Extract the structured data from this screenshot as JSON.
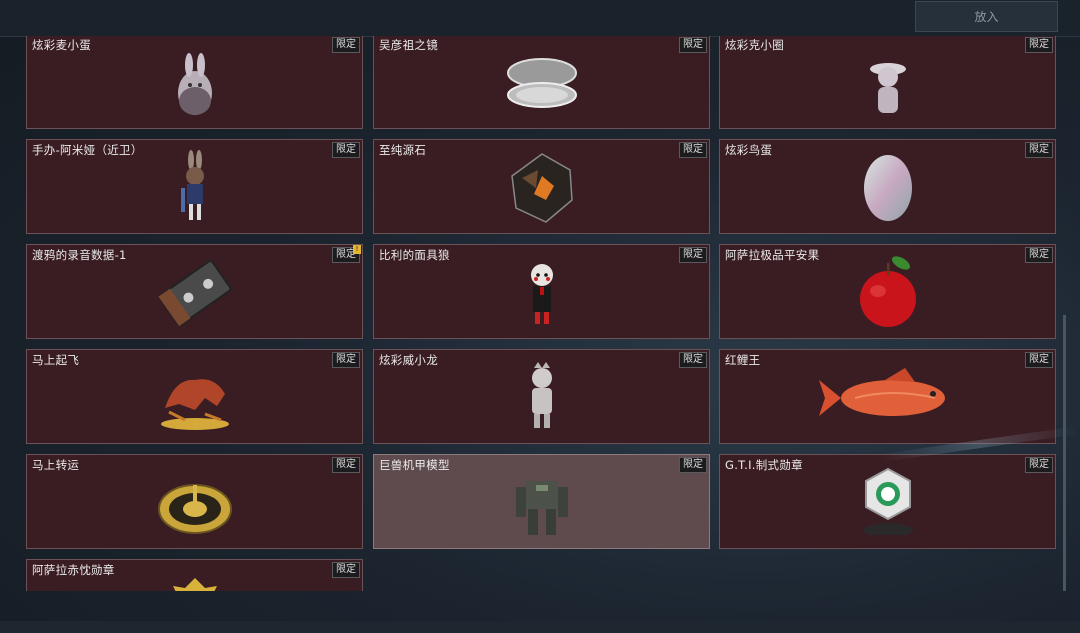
{
  "toolbar": {
    "put_in_label": "放入"
  },
  "tag_label": "限定",
  "items": [
    {
      "name": "炫彩麦小蛋",
      "icon": "bunny-egg-figure-icon"
    },
    {
      "name": "吴彦祖之镜",
      "icon": "compact-mirror-icon"
    },
    {
      "name": "炫彩克小圈",
      "icon": "hat-figure-icon"
    },
    {
      "name": "手办-阿米娅（近卫）",
      "icon": "amiya-figure-icon"
    },
    {
      "name": "至纯源石",
      "icon": "originium-crystal-icon"
    },
    {
      "name": "炫彩鸟蛋",
      "icon": "iridescent-egg-icon"
    },
    {
      "name": "渡鸦的录音数据-1",
      "icon": "cassette-tape-icon",
      "alert": "!"
    },
    {
      "name": "比利的面具狼",
      "icon": "puppet-figure-icon"
    },
    {
      "name": "阿萨拉极品平安果",
      "icon": "red-apple-icon"
    },
    {
      "name": "马上起飞",
      "icon": "horse-statue-icon"
    },
    {
      "name": "炫彩威小龙",
      "icon": "dragon-figure-icon"
    },
    {
      "name": "红鲤王",
      "icon": "red-carp-icon"
    },
    {
      "name": "马上转运",
      "icon": "golden-compass-icon"
    },
    {
      "name": "巨兽机甲模型",
      "icon": "mech-model-icon"
    },
    {
      "name": "G.T.I.制式勋章",
      "icon": "gti-medal-icon"
    },
    {
      "name": "阿萨拉赤忱勋章",
      "icon": "gold-medal-icon"
    }
  ]
}
